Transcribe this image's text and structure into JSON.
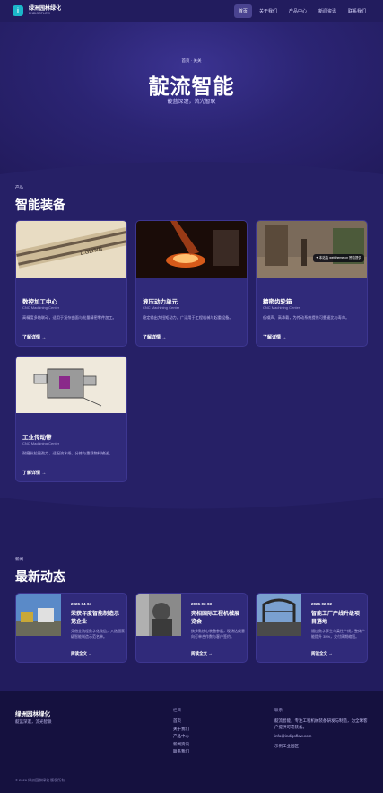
{
  "header": {
    "logo_letter": "i",
    "brand_name": "绿洲园林绿化",
    "brand_sub": "ENDIGOFLOW",
    "nav": [
      "首页",
      "关于我们",
      "产品中心",
      "新闻资讯",
      "联系我们"
    ]
  },
  "hero": {
    "breadcrumb": "首页 · 关关",
    "title": "靛流智能",
    "subtitle": "靛蓝深邃，流光智联"
  },
  "products": {
    "kicker": "产品",
    "title": "智能装备",
    "items": [
      {
        "title": "数控加工中心",
        "sub": "CNC Machining Center",
        "desc": "高精度多轴联动，适用于复杂曲面与批量精密零件加工。",
        "link": "了解详情 →"
      },
      {
        "title": "液压动力单元",
        "sub": "CNC Machining Center",
        "desc": "稳定输出大扭矩动力，广泛用于工程机械与起重设备。",
        "link": "了解详情 →"
      },
      {
        "title": "精密齿轮箱",
        "sub": "CNC Machining Center",
        "desc": "低噪声、高承载，为传动系统提供可靠速比与寿命。",
        "link": "了解详情 →",
        "badge": "✦ 本站由 webtheme.cn 赞助提供"
      },
      {
        "title": "工业传动带",
        "sub": "CNC Machining Center",
        "desc": "耐磨抗拉强劲力，适配流水线、分拣与重载物料输送。",
        "link": "了解详情 →"
      }
    ]
  },
  "news": {
    "kicker": "新闻",
    "title": "最新动态",
    "items": [
      {
        "date": "2026-04-04",
        "title": "荣获年度智能制造示范企业",
        "desc": "凭借全流程数字化改造，入选国家级智能制造示范名单。",
        "link": "阅读全文 →"
      },
      {
        "date": "2026-03-03",
        "title": "亮相国际工程机械展览会",
        "desc": "携多款核心装备参展，现场达成意向订单合作数与客户签约。",
        "link": "阅读全文 →"
      },
      {
        "date": "2026-02-02",
        "title": "智能工厂产线升级项目落地",
        "desc": "通过数字孪生与柔性产线，整体产能提升 35%，交付周期缩短。",
        "link": "阅读全文 →"
      }
    ]
  },
  "footer": {
    "brand": "绿洲园林绿化",
    "tagline": "靛蓝深邃，流光智联",
    "col1_title": "栏目",
    "links": [
      "首页",
      "关于我们",
      "产品中心",
      "新闻资讯",
      "联系我们"
    ],
    "col2_title": "联系",
    "contact": [
      "靛流智能，专注工程机械装备研发与制造，为全球客户提供可靠装备。",
      "info@indigoflow.com",
      "示例工业园区"
    ],
    "copyright": "© 2026 绿洲园林绿化 版权所有"
  },
  "colors": {
    "accent": "#1bb6c9",
    "page_bg": "#1b1650",
    "card_bg": "#302a7a",
    "footer_bg": "#15113f"
  }
}
